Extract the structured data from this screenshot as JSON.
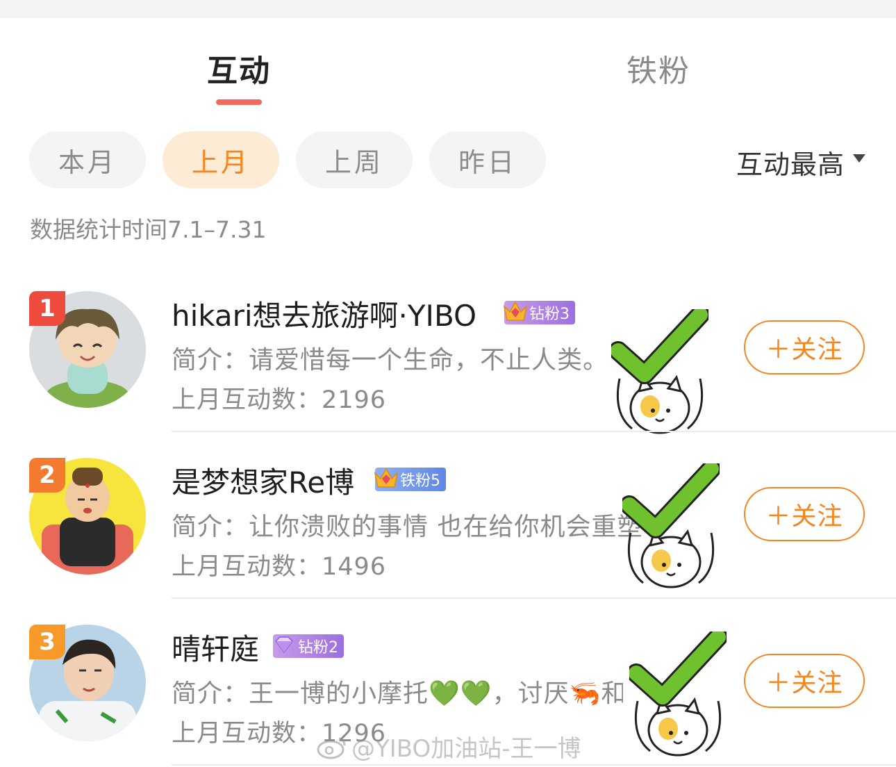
{
  "tabs": [
    {
      "label": "互动",
      "active": true
    },
    {
      "label": "铁粉",
      "active": false
    }
  ],
  "filters": [
    {
      "label": "本月",
      "selected": false
    },
    {
      "label": "上月",
      "selected": true
    },
    {
      "label": "上周",
      "selected": false
    },
    {
      "label": "昨日",
      "selected": false
    }
  ],
  "sort_label": "互动最高",
  "date_range": "数据统计时间7.1–7.31",
  "colors": {
    "accent": "#f7841c",
    "underline": "#f26a5e",
    "check": "#6fc22e"
  },
  "users": [
    {
      "rank": "1",
      "rank_color": "#ee4a3d",
      "name": "hikari想去旅游啊·YIBO",
      "badge_label": "钻粉3",
      "badge_icon": "crown-icon",
      "intro": "简介：请爱惜每一个生命，不止人类。",
      "count": "上月互动数：2196",
      "follow_label": "＋关注"
    },
    {
      "rank": "2",
      "rank_color": "#f47a30",
      "name": "是梦想家Re博",
      "badge_label": "铁粉5",
      "badge_icon": "crown-icon",
      "intro": "简介：让你溃败的事情 也在给你机会重塑",
      "count": "上月互动数：1496",
      "follow_label": "＋关注"
    },
    {
      "rank": "3",
      "rank_color": "#f79a2a",
      "name": "晴轩庭",
      "badge_label": "钻粉2",
      "badge_icon": "diamond-icon",
      "intro": "简介：王一博的小摩托💚💚，讨厌🦐和🦎",
      "count": "上月互动数：1296",
      "follow_label": "＋关注"
    }
  ],
  "watermark": "@YIBO加油站-王一博"
}
